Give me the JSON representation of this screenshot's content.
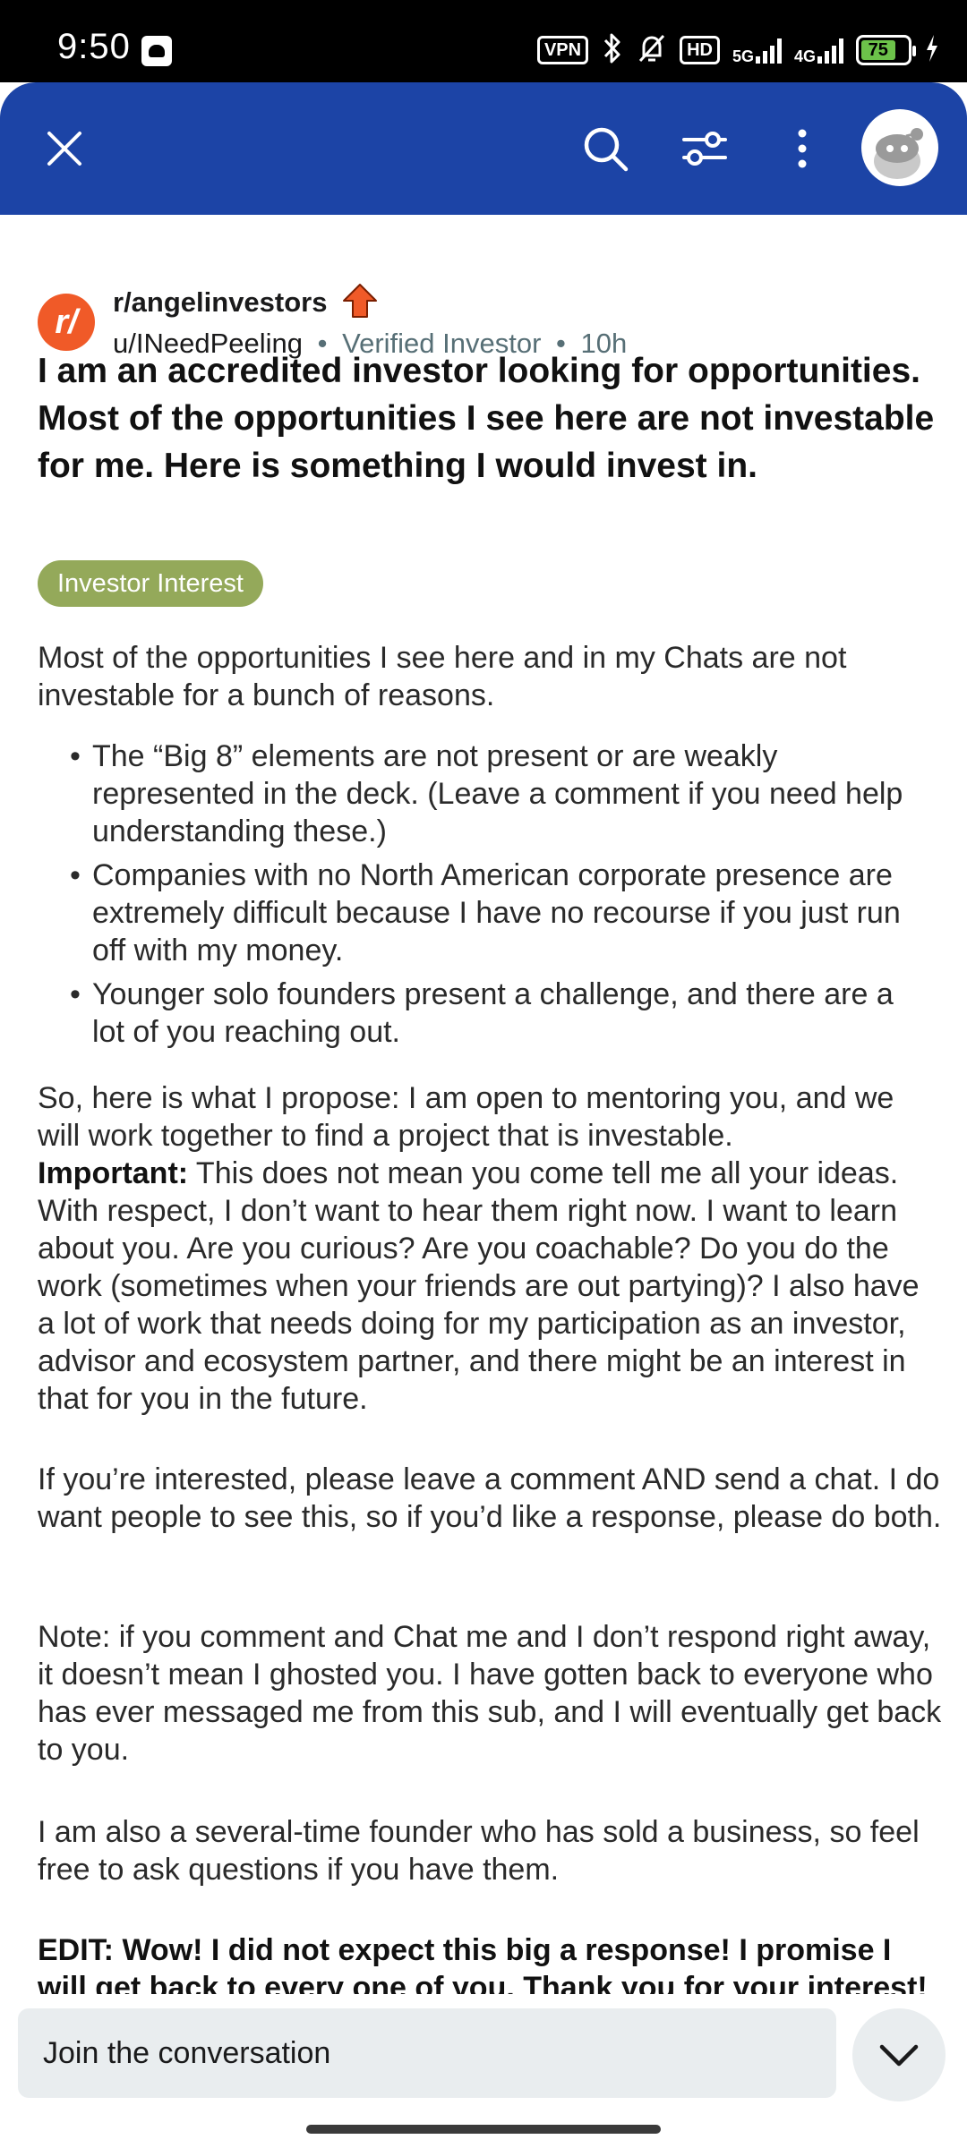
{
  "status_bar": {
    "time": "9:50",
    "vpn_label": "VPN",
    "hd_label": "HD",
    "net1": "5G",
    "net2": "4G",
    "battery_level": "75"
  },
  "app_bar": {
    "close_icon": "close-icon",
    "search_icon": "search-icon",
    "filter_icon": "filter-icon",
    "more_icon": "more-vertical-icon",
    "avatar_icon": "avatar-icon",
    "background_color": "#1c44a6"
  },
  "post": {
    "subreddit_logo": "r/",
    "subreddit": "r/angelinvestors",
    "author": "u/INeedPeeling",
    "author_flair": "Verified Investor",
    "sep": "•",
    "age": "10h",
    "title": "I am an accredited investor looking for opportunities. Most of the opportunities I see here are not investable for me. Here is something I would invest in.",
    "flair": "Investor Interest",
    "flair_color": "#94a95a",
    "intro": "Most of the opportunities I see here and in my Chats are not investable for a bunch of reasons.",
    "bullets": [
      "The “Big 8” elements are not present or are weakly represented in the deck. (Leave a comment if you need help understanding these.)",
      "Companies with no North American corporate presence are extremely difficult because I have no recourse if you just run off with my money.",
      "Younger solo founders present a challenge, and there are a lot of you reaching out."
    ],
    "para1_start": "So, here is what I propose: I am open to mentoring you, and we will work together to find a project that is investable.",
    "para1_bold": "Important:",
    "para1_rest": " This does not mean you come tell me all your ideas. With respect, I don’t want to hear them right now. I want to learn about you. Are you curious? Are you coachable? Do you do the work (sometimes when your friends are out partying)? I also have a lot of work that needs doing for my participation as an investor, advisor and ecosystem partner, and there might be an interest in that for you in the future.",
    "para2": "If you’re interested, please leave a comment AND send a chat. I do want people to see this, so if you’d like a response, please do both.",
    "para3": "Note: if you comment and Chat me and I don’t respond right away, it doesn’t mean I ghosted you. I have gotten back to everyone who has ever messaged me from this sub, and I will eventually get back to you.",
    "para4": "I am also a several-time founder who has sold a business, so feel free to ask questions if you have them.",
    "edit": "EDIT: Wow! I did not expect this big a response! I promise I will get back to every one of you. Thank you for your interest!"
  },
  "bottom": {
    "composer_placeholder": "Join the conversation",
    "collapse_icon": "chevron-down-icon"
  }
}
